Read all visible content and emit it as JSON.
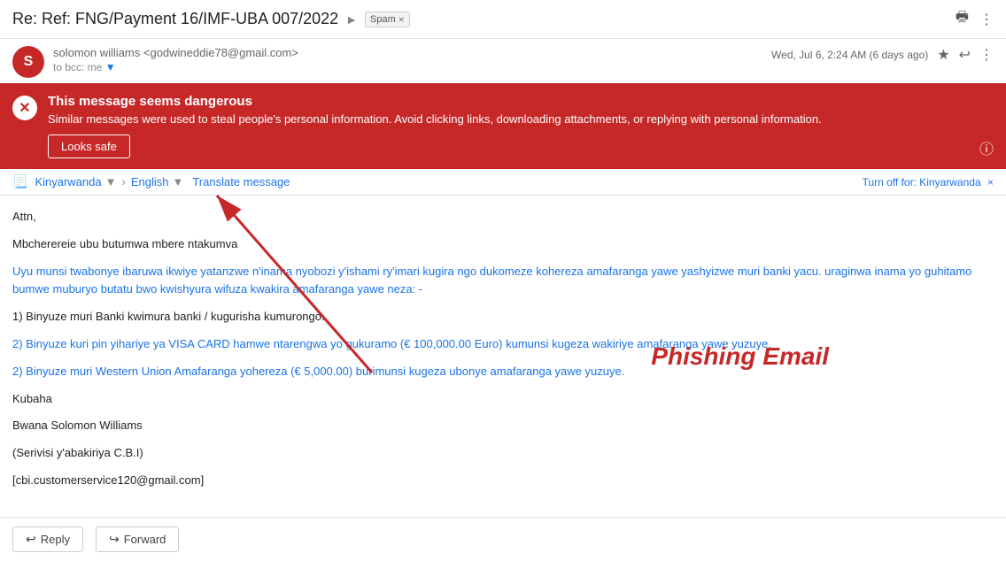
{
  "header": {
    "subject": "Re: Ref: FNG/Payment 16/IMF-UBA 007/2022",
    "spam_label": "Spam",
    "spam_x": "×"
  },
  "sender": {
    "name": "solomon williams",
    "email": "<godwineddie78@gmail.com>",
    "to_label": "to bcc: me",
    "date": "Wed, Jul 6, 2:24 AM (6 days ago)",
    "avatar_letter": "S"
  },
  "danger_banner": {
    "title": "This message seems dangerous",
    "description": "Similar messages were used to steal people's personal information. Avoid clicking links, downloading attachments, or replying with personal information.",
    "safe_button": "Looks safe"
  },
  "translate_bar": {
    "from_lang": "Kinyarwanda",
    "to_lang": "English",
    "translate_link": "Translate message",
    "turn_off_label": "Turn off for: Kinyarwanda",
    "turn_off_x": "×"
  },
  "body": {
    "line1": "Attn,",
    "line2": "Mbcherereie ubu butumwa mbere ntakumva",
    "para1": "Uyu munsi twabonye ibaruwa ikwiye yatanzwe n'inama nyobozi y'ishami ry'imari kugira ngo dukomeze kohereza amafaranga yawe yashyizwe muri banki yacu. uraginwa inama yo guhitamo bumwe muburyo butatu bwo kwishyura wifuza kwakira amafaranga yawe neza: -",
    "item1": "1) Binyuze muri Banki kwimura banki / kugurisha kumurongo.",
    "para2_line1": "2) Binyuze kuri pin yihariye ya VISA CARD hamwe ntarengwa yo gukuramo (€ 100,000.00 Euro) kumunsi kugeza wakiriye amafaranga yawe yuzuye.",
    "para3_line1": "2) Binyuze muri Western Union Amafaranga yohereza (€ 5,000.00) burimunsi kugeza ubonye amafaranga yawe yuzuye.",
    "closing1": "Kubaha",
    "closing2": "Bwana Solomon Williams",
    "closing3": "(Serivisi y'abakiriya C.B.I)",
    "closing4": "[cbi.customerservice120@gmail.com]",
    "phishing_label": "Phishing Email"
  },
  "bottom_actions": {
    "reply_label": "Reply",
    "forward_label": "Forward"
  }
}
